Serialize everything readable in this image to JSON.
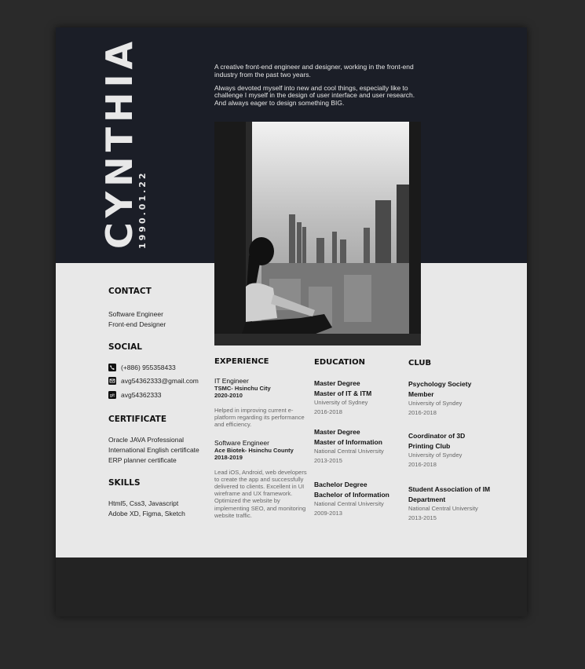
{
  "name": "CYNTHIA",
  "birthdate": "1990.01.22",
  "intro": {
    "p1": "A creative front-end engineer and designer, working in the front-end industry from the past two years.",
    "p2": "Always devoted myself into new and cool things, especially like to challenge I myself in the design of user interface and user research. And always eager to design something BIG."
  },
  "contact": {
    "title": "CONTACT",
    "lines": [
      "Software Engineer",
      "Front-end Designer"
    ]
  },
  "social": {
    "title": "SOCIAL",
    "items": [
      {
        "icon": "phone-icon",
        "text": "(+886) 955358433"
      },
      {
        "icon": "mail-icon",
        "text": "avg54362333@gmail.com"
      },
      {
        "icon": "gitlab-icon",
        "text": "avg54362333"
      }
    ]
  },
  "certificate": {
    "title": "CERTIFICATE",
    "lines": [
      "Oracle JAVA Professional",
      "International English certificate",
      "ERP planner certificate"
    ]
  },
  "skills": {
    "title": "SKILLS",
    "lines": [
      "Html5, Css3, Javascript",
      "Adobe XD, Figma, Sketch"
    ]
  },
  "experience": {
    "title": "EXPERIENCE",
    "items": [
      {
        "role": "IT Engineer",
        "company": "TSMC- Hsinchu City",
        "period": "2020-2010",
        "desc": "Helped in improving current e-platform regarding its performance and efficiency."
      },
      {
        "role": "Software Engineer",
        "company": "Ace Biotek- Hsinchu County",
        "period": "2018-2019",
        "desc": "Lead iOS, Android, web developers to create the app and successfully delivered to clients. Excellent in UI wireframe and UX framework. Optimized the website by implementing SEO, and monitoring website traffic."
      }
    ]
  },
  "education": {
    "title": "EDUCATION",
    "items": [
      {
        "degree": "Master Degree",
        "field": "Master of IT & ITM",
        "school": "University of Sydney",
        "period": "2016-2018"
      },
      {
        "degree": "Master Degree",
        "field": "Master of Information",
        "school": "National Central University",
        "period": "2013-2015"
      },
      {
        "degree": "Bachelor Degree",
        "field": "Bachelor of Information",
        "school": "National Central University",
        "period": "2009-2013"
      }
    ]
  },
  "club": {
    "title": "CLUB",
    "items": [
      {
        "l1": "Psychology Society",
        "l2": "Member",
        "school": "University of Syndey",
        "period": "2016-2018"
      },
      {
        "l1": "Coordinator of 3D",
        "l2": "Printing Club",
        "school": "University of Syndey",
        "period": "2016-2018"
      },
      {
        "l1": "Student Association of IM",
        "l2": "Department",
        "school": "National Central University",
        "period": "2013-2015"
      }
    ]
  },
  "colors": {
    "dark_band": "#1b1e27",
    "page": "#e8e8e8",
    "backdrop": "#2a2a2a"
  }
}
